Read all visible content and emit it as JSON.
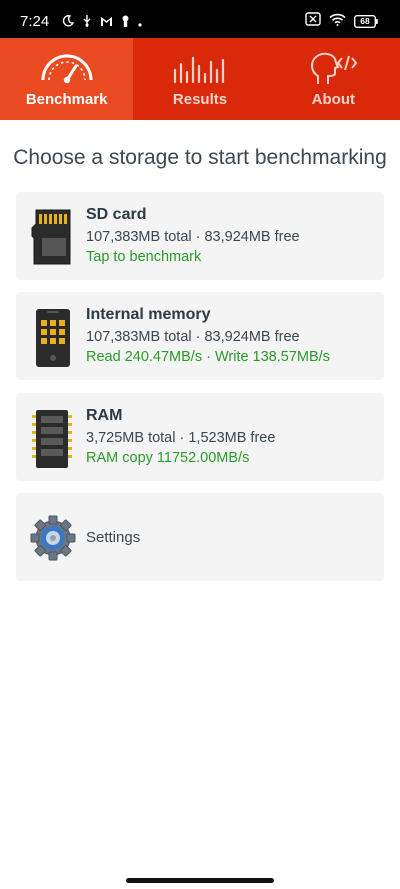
{
  "status_bar": {
    "time": "7:24",
    "battery": "68"
  },
  "tabs": [
    {
      "label": "Benchmark",
      "icon": "speedometer-icon",
      "active": true
    },
    {
      "label": "Results",
      "icon": "bars-icon",
      "active": false
    },
    {
      "label": "About",
      "icon": "head-code-icon",
      "active": false
    }
  ],
  "heading": "Choose a storage to start benchmarking",
  "storages": [
    {
      "title": "SD card",
      "capacity": "107,383MB total · 83,924MB free",
      "status": "Tap to benchmark",
      "icon": "sd-card-icon"
    },
    {
      "title": "Internal memory",
      "capacity": "107,383MB total · 83,924MB free",
      "status": "Read 240.47MB/s · Write 138.57MB/s",
      "icon": "phone-memory-icon"
    },
    {
      "title": "RAM",
      "capacity": "3,725MB total · 1,523MB free",
      "status": "RAM copy 11752.00MB/s",
      "icon": "ram-chip-icon"
    }
  ],
  "settings": {
    "label": "Settings",
    "icon": "gear-icon"
  },
  "colors": {
    "tab_bar": "#d9290a",
    "tab_active": "#ea4a21",
    "status_green": "#2a9a2a",
    "card_bg": "#f4f4f4"
  }
}
